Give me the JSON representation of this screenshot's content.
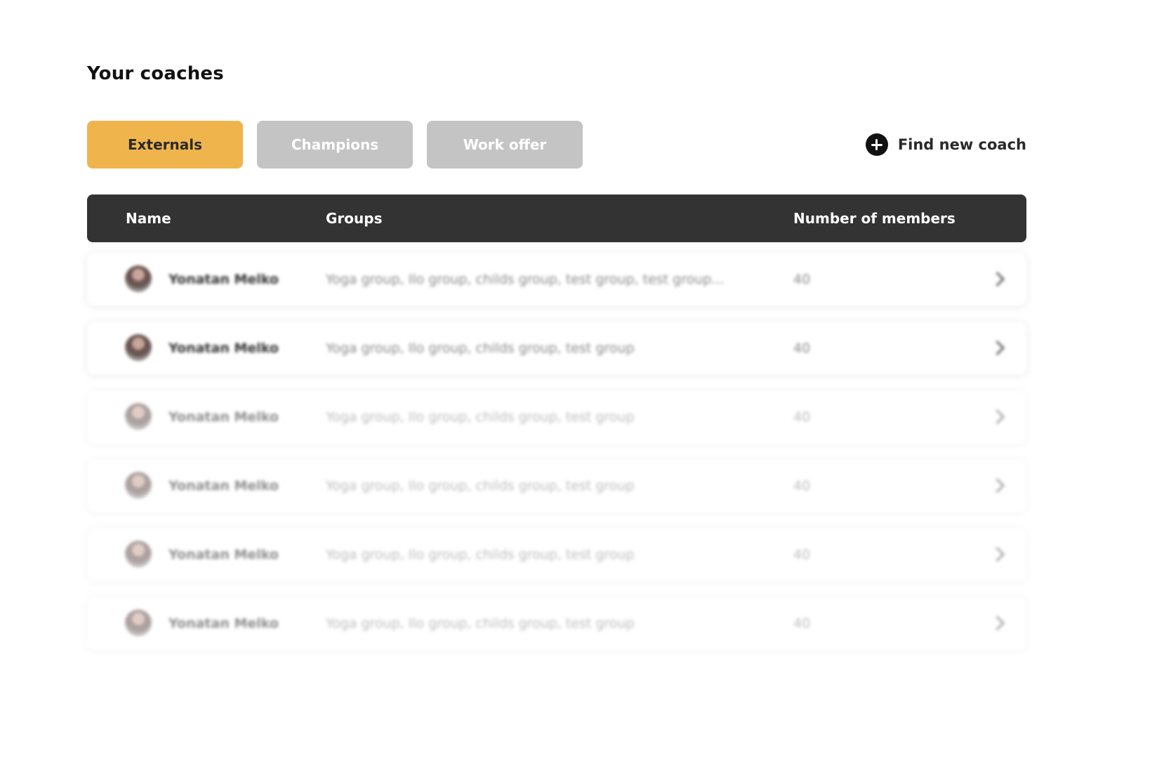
{
  "page": {
    "title": "Your coaches"
  },
  "tabs": [
    {
      "label": "Externals",
      "active": true
    },
    {
      "label": "Champions",
      "active": false
    },
    {
      "label": "Work offer",
      "active": false
    }
  ],
  "actions": {
    "find_new_coach_label": "Find new coach",
    "find_new_coach_icon": "plus-circle-icon"
  },
  "table": {
    "columns": {
      "name": "Name",
      "groups": "Groups",
      "members": "Number of members"
    },
    "rows": [
      {
        "name": "Yonatan Melko",
        "groups": "Yoga group, Ilo group, childs group, test group, test group...",
        "members": "40"
      },
      {
        "name": "Yonatan Melko",
        "groups": "Yoga group, Ilo group, childs group, test group",
        "members": "40"
      },
      {
        "name": "Yonatan Melko",
        "groups": "Yoga group, Ilo group, childs group, test group",
        "members": "40"
      },
      {
        "name": "Yonatan Melko",
        "groups": "Yoga group, Ilo group, childs group, test group",
        "members": "40"
      },
      {
        "name": "Yonatan Melko",
        "groups": "Yoga group, Ilo group, childs group, test group",
        "members": "40"
      },
      {
        "name": "Yonatan Melko",
        "groups": "Yoga group, Ilo group, childs group, test group",
        "members": "40"
      }
    ]
  },
  "colors": {
    "accent": "#efb54c",
    "tab_inactive": "#c4c4c4",
    "header_bg": "#333333"
  }
}
